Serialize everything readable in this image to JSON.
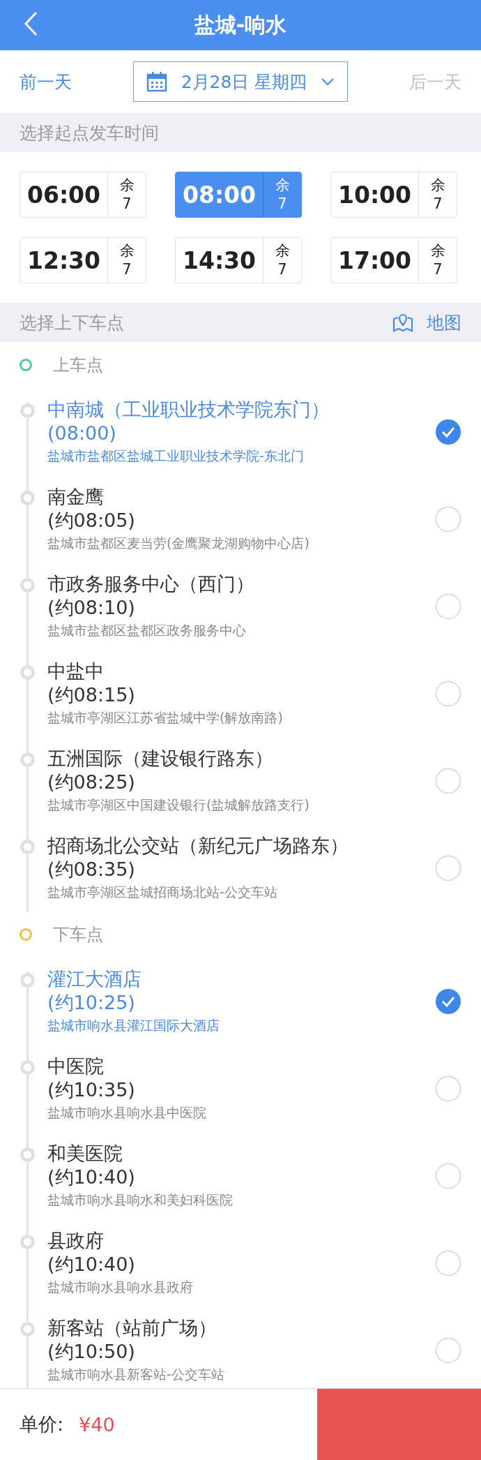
{
  "header": {
    "title": "盐城-响水"
  },
  "date_bar": {
    "prev": "前一天",
    "date": "2月28日 星期四",
    "next": "后一天",
    "next_disabled": true
  },
  "time_section": {
    "title": "选择起点发车时间",
    "slots": [
      {
        "time": "06:00",
        "remain_label": "余",
        "remain": "7",
        "selected": false
      },
      {
        "time": "08:00",
        "remain_label": "余",
        "remain": "7",
        "selected": true
      },
      {
        "time": "10:00",
        "remain_label": "余",
        "remain": "7",
        "selected": false
      },
      {
        "time": "12:30",
        "remain_label": "余",
        "remain": "7",
        "selected": false
      },
      {
        "time": "14:30",
        "remain_label": "余",
        "remain": "7",
        "selected": false
      },
      {
        "time": "17:00",
        "remain_label": "余",
        "remain": "7",
        "selected": false
      }
    ]
  },
  "stop_section": {
    "title": "选择上下车点",
    "map_link": "地图",
    "groups": [
      {
        "label": "上车点",
        "color": "#4fcb9b",
        "stops": [
          {
            "name": "中南城（工业职业技术学院东门）",
            "time": "(08:00)",
            "address": "盐城市盐都区盐城工业职业技术学院-东北门",
            "selected": true
          },
          {
            "name": "南金鹰",
            "time": "(约08:05)",
            "address": "盐城市盐都区麦当劳(金鹰聚龙湖购物中心店)",
            "selected": false
          },
          {
            "name": "市政务服务中心（西门）",
            "time": "(约08:10)",
            "address": "盐城市盐都区盐都区政务服务中心",
            "selected": false
          },
          {
            "name": "中盐中",
            "time": "(约08:15)",
            "address": "盐城市亭湖区江苏省盐城中学(解放南路)",
            "selected": false
          },
          {
            "name": "五洲国际（建设银行路东）",
            "time": "(约08:25)",
            "address": "盐城市亭湖区中国建设银行(盐城解放路支行)",
            "selected": false
          },
          {
            "name": "招商场北公交站（新纪元广场路东）",
            "time": "(约08:35)",
            "address": "盐城市亭湖区盐城招商场北站-公交车站",
            "selected": false
          }
        ]
      },
      {
        "label": "下车点",
        "color": "#f0c040",
        "stops": [
          {
            "name": "灌江大酒店",
            "time": "(约10:25)",
            "address": "盐城市响水县灌江国际大酒店",
            "selected": true
          },
          {
            "name": "中医院",
            "time": "(约10:35)",
            "address": "盐城市响水县响水县中医院",
            "selected": false
          },
          {
            "name": "和美医院",
            "time": "(约10:40)",
            "address": "盐城市响水县响水和美妇科医院",
            "selected": false
          },
          {
            "name": "县政府",
            "time": "(约10:40)",
            "address": "盐城市响水县响水县政府",
            "selected": false
          },
          {
            "name": "新客站（站前广场）",
            "time": "(约10:50)",
            "address": "盐城市响水县新客站-公交车站",
            "selected": false
          }
        ]
      }
    ]
  },
  "footer": {
    "price_label": "单价:",
    "price": "¥40"
  }
}
